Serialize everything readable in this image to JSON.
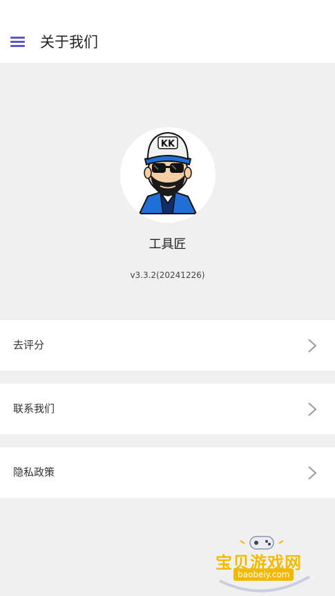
{
  "header": {
    "title": "关于我们",
    "menu_icon": "hamburger-menu-icon",
    "accent": "#5b57c8"
  },
  "app": {
    "name": "工具匠",
    "version": "v3.3.2(20241226)",
    "logo_text": "KK"
  },
  "menu_rows": [
    {
      "label": "去评分",
      "icon": "chevron-right-icon"
    },
    {
      "label": "联系我们",
      "icon": "chevron-right-icon"
    },
    {
      "label": "隐私政策",
      "icon": "chevron-right-icon"
    }
  ],
  "watermark": {
    "text": "宝贝游戏网",
    "url": "baobeiy.com"
  },
  "colors": {
    "background": "#f0f0f0",
    "card": "#ffffff",
    "chevron": "#999999"
  }
}
